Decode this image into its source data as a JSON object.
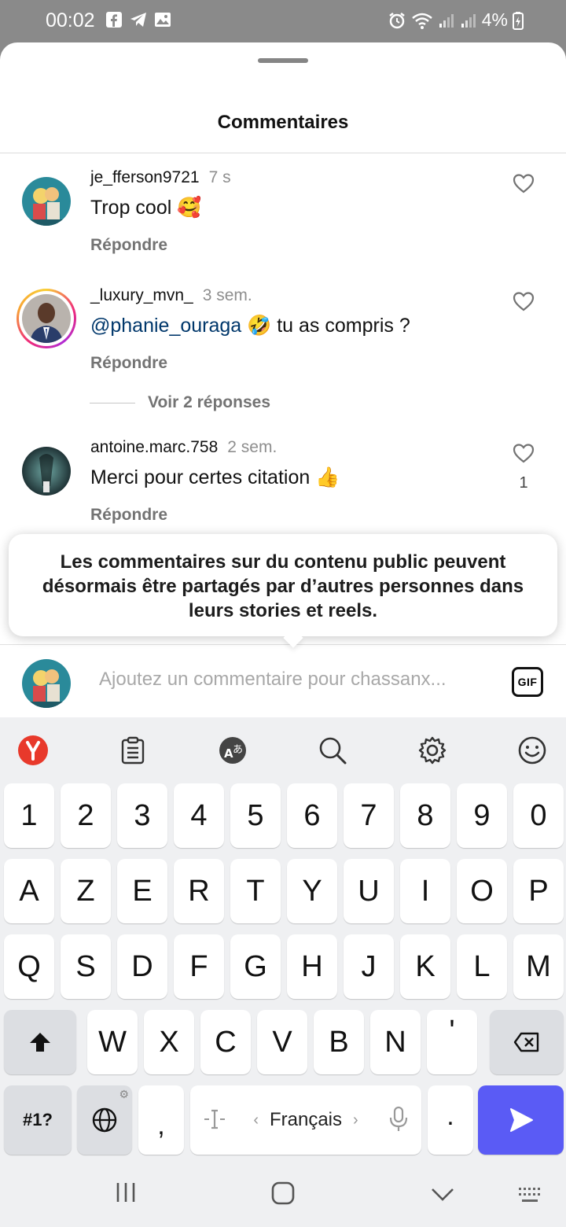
{
  "status_bar": {
    "time": "00:02",
    "left_icons": [
      "facebook-icon",
      "telegram-icon",
      "gallery-icon"
    ],
    "right_icons": [
      "alarm-icon",
      "wifi-icon",
      "signal-icon",
      "signal-icon",
      "battery-icon"
    ],
    "battery": "4%"
  },
  "sheet": {
    "title": "Commentaires"
  },
  "comments": [
    {
      "username": "je_fferson9721",
      "time": "7 s",
      "text": "Trop cool 🥰",
      "mention": "",
      "reply_label": "Répondre",
      "likes": ""
    },
    {
      "username": "_luxury_mvn_",
      "time": "3 sem.",
      "mention": "@phanie_ouraga",
      "text": " 🤣 tu as compris ?",
      "reply_label": "Répondre",
      "likes": ""
    },
    {
      "username": "antoine.marc.758",
      "time": "2 sem.",
      "text": "Merci pour certes citation 👍",
      "mention": "",
      "reply_label": "Répondre",
      "likes": "1"
    }
  ],
  "view_replies": "Voir 2 réponses",
  "tooltip": "Les commentaires sur du contenu public peuvent désormais être partagés par d’autres personnes dans leurs stories et reels.",
  "composer": {
    "placeholder": "Ajoutez un commentaire pour chassanx...",
    "gif_label": "GIF"
  },
  "keyboard": {
    "toolbar": [
      "yandex-icon",
      "clipboard-icon",
      "translate-icon",
      "search-icon",
      "settings-icon",
      "emoji-icon"
    ],
    "row_numbers": [
      "1",
      "2",
      "3",
      "4",
      "5",
      "6",
      "7",
      "8",
      "9",
      "0"
    ],
    "row1": [
      "A",
      "Z",
      "E",
      "R",
      "T",
      "Y",
      "U",
      "I",
      "O",
      "P"
    ],
    "row2": [
      "Q",
      "S",
      "D",
      "F",
      "G",
      "H",
      "J",
      "K",
      "L",
      "M"
    ],
    "row3": [
      "W",
      "X",
      "C",
      "V",
      "B",
      "N",
      "'"
    ],
    "symbols_label": "#1?",
    "comma": ",",
    "period": ".",
    "language": "Français"
  },
  "colors": {
    "accent_enter": "#5a5bf5",
    "mention": "#00376b",
    "yandex": "#e8392b"
  }
}
